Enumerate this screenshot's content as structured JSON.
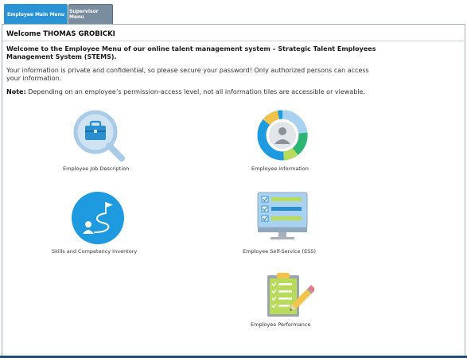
{
  "tabs": {
    "main": "Employee Main Menu",
    "supervisor": "Supervisor Menu"
  },
  "welcome": "Welcome THOMAS GROBICKI",
  "intro": "Welcome to the Employee Menu of our online talent management system – Strategic Talent Employees Management System (STEMS).",
  "privacy": "Your information is private and confidential, so please secure your password! Only authorized persons can access your information.",
  "note": {
    "label": "Note:",
    "text": "Depending on an employee’s permission-access level, not all information tiles are accessible or viewable."
  },
  "tiles": {
    "job_description": "Employee Job Description",
    "employee_information": "Employee Information",
    "skills": "Skills and Competency Inventory",
    "self_service": "Employee Self-Service (ESS)",
    "performance": "Employee Performance"
  },
  "colors": {
    "tab_active": "#2a93d5",
    "tab_inactive": "#7a8d9e",
    "accent_blue": "#1e9be0",
    "light_blue": "#a9d2f0"
  }
}
